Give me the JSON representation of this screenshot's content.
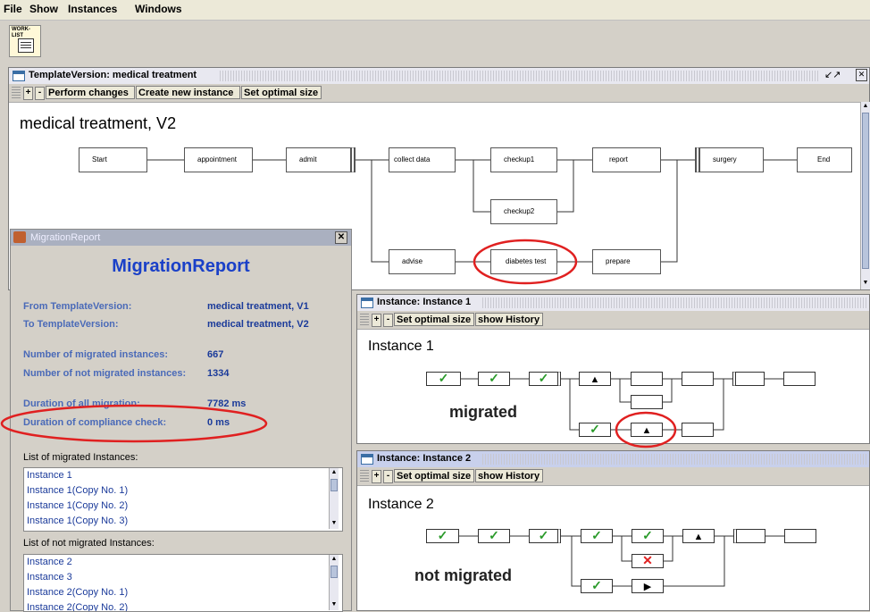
{
  "menu": [
    "File",
    "Show",
    "Instances",
    "Windows"
  ],
  "toolbar": {
    "worklist_label": "WORK- LIST"
  },
  "template_window": {
    "title": "TemplateVersion: medical treatment",
    "buttons": {
      "plus": "+",
      "minus": "-",
      "perform": "Perform changes",
      "create": "Create new instance",
      "optimal": "Set optimal size"
    },
    "heading": "medical treatment, V2",
    "nodes": [
      "Start",
      "appointment",
      "admit",
      "collect data",
      "checkup1",
      "report",
      "surgery",
      "End",
      "checkup2",
      "advise",
      "diabetes test",
      "prepare"
    ]
  },
  "migration_report": {
    "window_title": "MigrationReport",
    "heading": "MigrationReport",
    "rows": [
      {
        "label": "From TemplateVersion:",
        "value": "medical treatment, V1"
      },
      {
        "label": "To TemplateVersion:",
        "value": "medical treatment, V2"
      },
      {
        "label": "Number of migrated instances:",
        "value": "667"
      },
      {
        "label": "Number of not migrated instances:",
        "value": "1334"
      },
      {
        "label": "Duration of all migration:",
        "value": "7782 ms"
      },
      {
        "label": "Duration of compliance check:",
        "value": "0 ms"
      }
    ],
    "migrated_list_label": "List of migrated Instances:",
    "migrated_list": [
      "Instance 1",
      "Instance 1(Copy No. 1)",
      "Instance 1(Copy No. 2)",
      "Instance 1(Copy No. 3)"
    ],
    "not_migrated_list_label": "List of not migrated Instances:",
    "not_migrated_list": [
      "Instance 2",
      "Instance 3",
      "Instance 2(Copy No. 1)",
      "Instance 2(Copy No. 2)"
    ]
  },
  "instance1": {
    "title": "Instance: Instance 1",
    "buttons": {
      "plus": "+",
      "minus": "-",
      "optimal": "Set optimal size",
      "history": "show History"
    },
    "heading": "Instance 1",
    "status": "migrated"
  },
  "instance2": {
    "title": "Instance: Instance 2",
    "buttons": {
      "plus": "+",
      "minus": "-",
      "optimal": "Set optimal size",
      "history": "show History"
    },
    "heading": "Instance 2",
    "status": "not migrated"
  },
  "colors": {
    "highlight": "#e02020",
    "check": "#2a9a2a",
    "link": "#1a3a9a"
  }
}
